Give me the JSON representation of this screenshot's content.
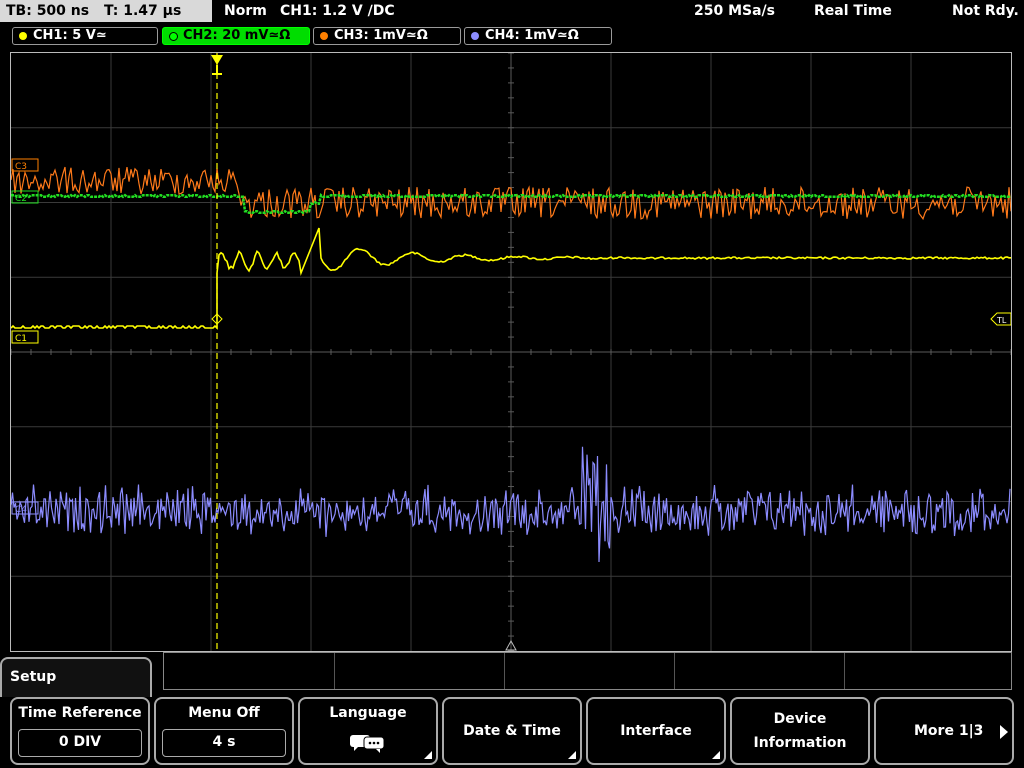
{
  "topbar": {
    "timebase": "TB: 500 ns",
    "trigger_time": "T: 1.47 µs",
    "mode": "Norm",
    "trigger_info": "CH1: 1.2 V ∕DC",
    "sample_rate": "250 MSa/s",
    "acq_mode": "Real Time",
    "status": "Not Rdy."
  },
  "channels": [
    {
      "label": "CH1: 5 V≃",
      "color": "#ffff00"
    },
    {
      "label": "CH2: 20 mV≃Ω",
      "color": "#00ff00"
    },
    {
      "label": "CH3: 1mV≃Ω",
      "color": "#ff8000"
    },
    {
      "label": "CH4: 1mV≃Ω",
      "color": "#8c8cff"
    }
  ],
  "markers": {
    "c3": "C3",
    "c2": "C2",
    "c1": "C1",
    "c4": "C4",
    "tl": "TL"
  },
  "menu": {
    "title": "Setup",
    "time_reference": {
      "label": "Time Reference",
      "value": "0 DIV"
    },
    "menu_off": {
      "label": "Menu Off",
      "value": "4 s"
    },
    "language": "Language",
    "date_time": "Date & Time",
    "interface": "Interface",
    "device_info_line1": "Device",
    "device_info_line2": "Information",
    "more": "More 1|3"
  }
}
